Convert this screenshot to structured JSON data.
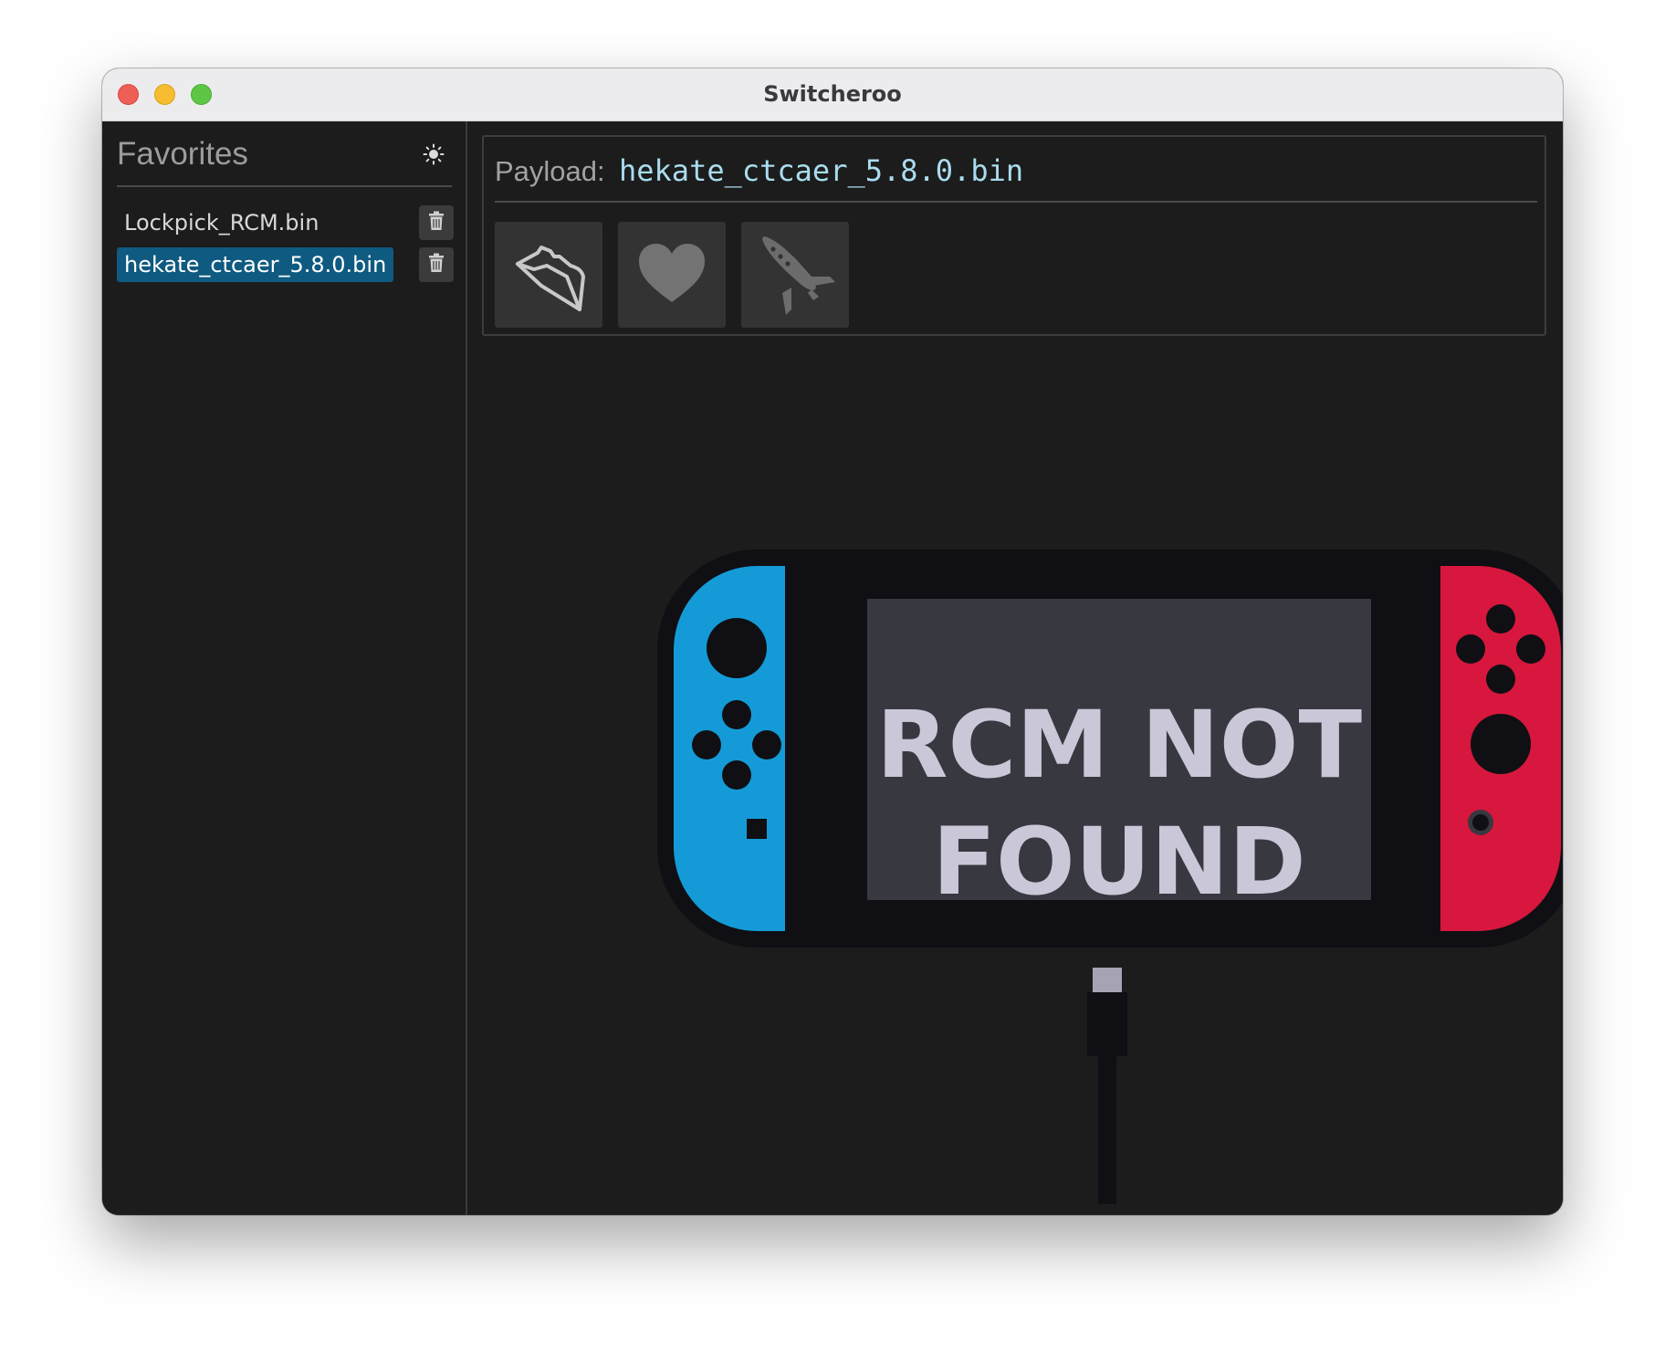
{
  "window": {
    "title": "Switcheroo"
  },
  "sidebar": {
    "title": "Favorites",
    "theme_icon": "sun-icon",
    "items": [
      {
        "label": "Lockpick_RCM.bin",
        "selected": false,
        "delete_icon": "trash-icon"
      },
      {
        "label": "hekate_ctcaer_5.8.0.bin",
        "selected": true,
        "delete_icon": "trash-icon"
      }
    ]
  },
  "payload": {
    "label": "Payload:",
    "value": "hekate_ctcaer_5.8.0.bin"
  },
  "toolbar": {
    "buttons": [
      {
        "name": "open-folder-button",
        "icon": "folder-icon"
      },
      {
        "name": "favorite-button",
        "icon": "heart-icon"
      },
      {
        "name": "launch-button",
        "icon": "rocket-icon"
      }
    ]
  },
  "status": {
    "line1": "RCM NOT",
    "line2": "FOUND"
  },
  "colors": {
    "accent_selected": "#0f5a80",
    "payload_text": "#a9dcee",
    "joycon_left": "#149bd7",
    "joycon_right": "#d7173d",
    "screen": "#383841",
    "status_text": "#cac8d8"
  }
}
